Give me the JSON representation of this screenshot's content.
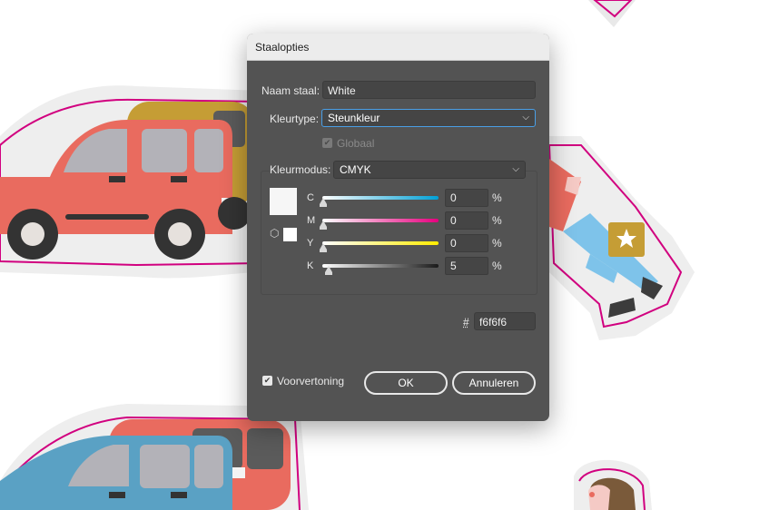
{
  "dialog": {
    "title": "Staalopties",
    "swatch_name_label": "Naam staal:",
    "swatch_name_value": "White",
    "color_type_label": "Kleurtype:",
    "color_type_value": "Steunkleur",
    "global_label": "Globaal",
    "global_checked": true,
    "color_mode_label": "Kleurmodus:",
    "color_mode_value": "CMYK",
    "swatch_color": "#f6f6f6",
    "channels": [
      {
        "label": "C",
        "value": "0",
        "unit": "%",
        "gradient": "linear-gradient(to right,#ffffff,#00a0d6)"
      },
      {
        "label": "M",
        "value": "0",
        "unit": "%",
        "gradient": "linear-gradient(to right,#ffffff,#e6007e)"
      },
      {
        "label": "Y",
        "value": "0",
        "unit": "%",
        "gradient": "linear-gradient(to right,#ffffff,#ffec00)"
      },
      {
        "label": "K",
        "value": "5",
        "unit": "%",
        "gradient": "linear-gradient(to right,#ffffff,#1a1a1a)"
      }
    ],
    "hex_symbol": "#",
    "hex_value": "f6f6f6",
    "preview_label": "Voorvertoning",
    "preview_checked": true,
    "ok_label": "OK",
    "cancel_label": "Annuleren"
  },
  "colors": {
    "dialog_bg": "#535353",
    "focus_ring": "#4a9fe6",
    "sticker_outline": "#d1007f"
  }
}
